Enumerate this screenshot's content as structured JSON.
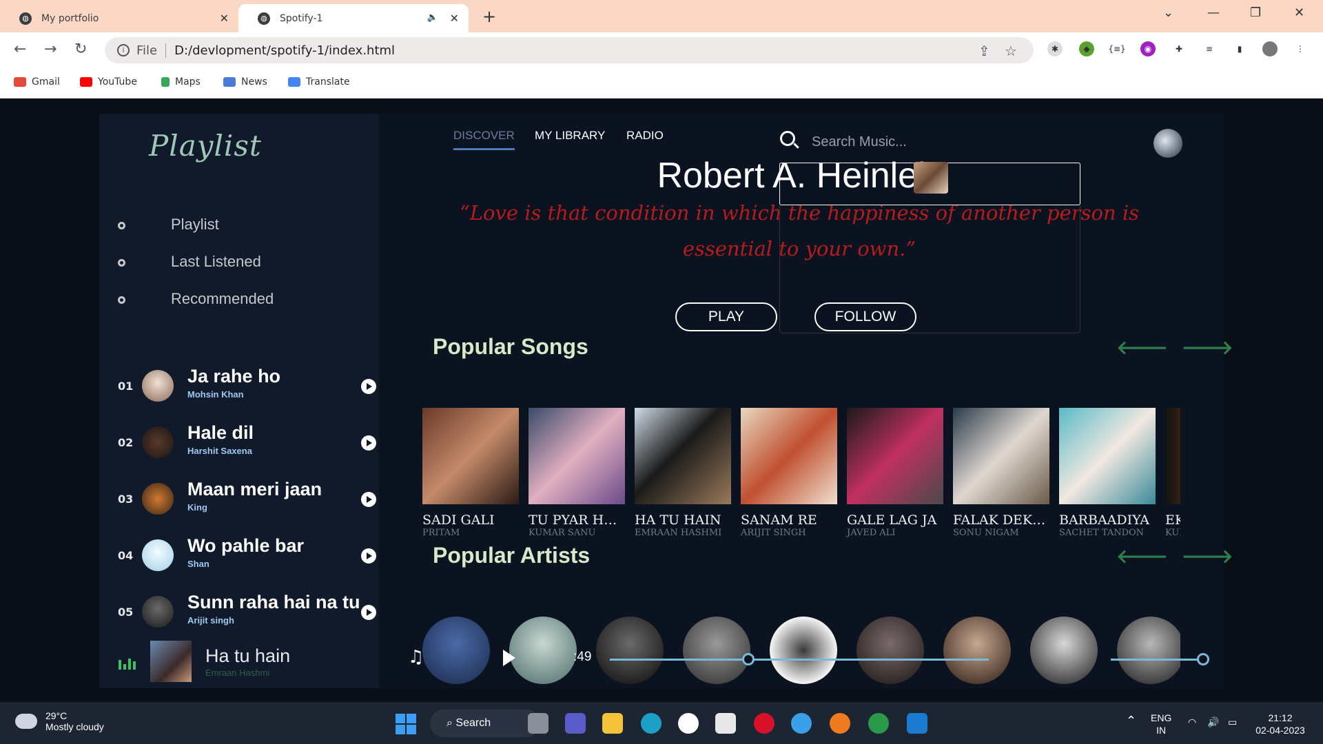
{
  "browser": {
    "tabs": [
      {
        "title": "My portfolio"
      },
      {
        "title": "Spotify-1"
      }
    ],
    "address": {
      "scheme_label": "File",
      "url": "D:/devlopment/spotify-1/index.html"
    },
    "bookmarks": [
      "Gmail",
      "YouTube",
      "Maps",
      "News",
      "Translate"
    ]
  },
  "sidebar": {
    "brand": "Playlist",
    "menu": [
      "Playlist",
      "Last Listened",
      "Recommended"
    ],
    "songs": [
      {
        "num": "01",
        "title": "Ja rahe ho",
        "artist": "Mohsin Khan"
      },
      {
        "num": "02",
        "title": "Hale dil",
        "artist": "Harshit Saxena"
      },
      {
        "num": "03",
        "title": "Maan meri jaan",
        "artist": "King"
      },
      {
        "num": "04",
        "title": "Wo pahle bar",
        "artist": "Shan"
      },
      {
        "num": "05",
        "title": "Sunn raha hai na tu",
        "artist": "Arijit singh"
      }
    ],
    "now_playing": {
      "title": "Ha tu hain",
      "artist": "Emraan Hashmi"
    }
  },
  "topnav": {
    "tabs": [
      "DISCOVER",
      "MY LIBRARY",
      "RADIO"
    ],
    "search_placeholder": "Search Music..."
  },
  "hero": {
    "title": "Robert A. Heinlein",
    "quote": "“Love is that condition in which the happiness of another person is essential to your own.”",
    "play_label": "PLAY",
    "follow_label": "FOLLOW"
  },
  "popular_songs": {
    "title": "Popular Songs",
    "items": [
      {
        "name": "SADI GALI",
        "artist": "PRITAM"
      },
      {
        "name": "TU PYAR HAI KISI AUR KA",
        "artist": "KUMAR SANU"
      },
      {
        "name": "HA TU HAIN",
        "artist": "EMRAAN HASHMI"
      },
      {
        "name": "SANAM RE",
        "artist": "ARIJIT SINGH"
      },
      {
        "name": "GALE LAG JA",
        "artist": "JAVED ALI"
      },
      {
        "name": "FALAK DEKHUN",
        "artist": "SONU NIGAM"
      },
      {
        "name": "BARBAADIYA",
        "artist": "SACHET TANDON"
      },
      {
        "name": "EK",
        "artist": "KUNAL"
      }
    ]
  },
  "popular_artists": {
    "title": "Popular Artists"
  },
  "player": {
    "time": ":49"
  },
  "taskbar": {
    "weather_temp": "29°C",
    "weather_cond": "Mostly cloudy",
    "search_label": "Search",
    "lang_top": "ENG",
    "lang_bottom": "IN",
    "time": "21:12",
    "date": "02-04-2023"
  }
}
